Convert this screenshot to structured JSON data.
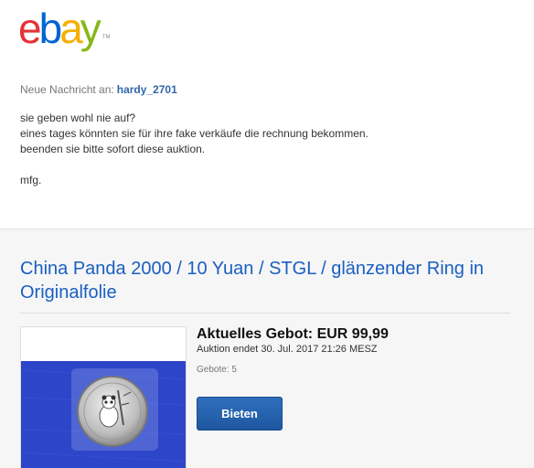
{
  "brand": {
    "letters": [
      "e",
      "b",
      "a",
      "y"
    ],
    "letter_colors": [
      "#e53238",
      "#0064d2",
      "#f5af02",
      "#86b817"
    ],
    "tm": "TM"
  },
  "message": {
    "to_label": "Neue Nachricht an:",
    "to_user": "hardy_2701",
    "lines": [
      "sie geben wohl nie auf?",
      "eines tages könnten sie für ihre fake verkäufe die rechnung bekommen.",
      "beenden sie bitte sofort diese auktion.",
      "",
      "mfg."
    ]
  },
  "listing": {
    "title": "China Panda 2000 / 10 Yuan / STGL / glänzender Ring in Originalfolie",
    "price": "Aktuelles Gebot: EUR 99,99",
    "ends": "Auktion endet 30. Jul. 2017 21:26 MESZ",
    "bids": "Gebote: 5",
    "bid_button": "Bieten",
    "image_icon": "silver-panda-coin-photo"
  },
  "colors": {
    "link_blue": "#1a5fc2",
    "button_blue": "#2563b0",
    "section_bg": "#f6f6f6"
  }
}
